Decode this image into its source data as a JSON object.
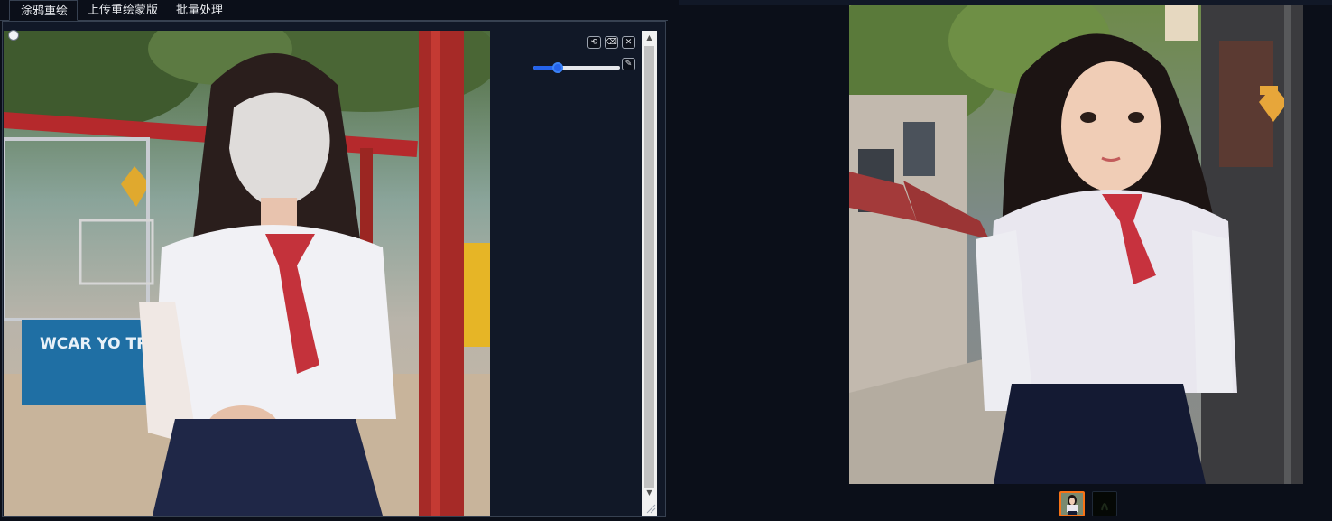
{
  "tabs": [
    {
      "label": "涂鸦重绘",
      "active": true
    },
    {
      "label": "上传重绘蒙版",
      "active": false
    },
    {
      "label": "批量处理",
      "active": false
    }
  ],
  "editor": {
    "tools": [
      {
        "name": "undo-icon",
        "glyph": "⟲"
      },
      {
        "name": "eraser-icon",
        "glyph": "⌫"
      },
      {
        "name": "clear-icon",
        "glyph": "✕"
      }
    ],
    "brush_tool_glyph": "✎",
    "brush_size_fraction": 0.25,
    "sign_text": "WCAR YO TRE"
  },
  "colors": {
    "accent": "#2563eb",
    "selected_thumb_border": "#f97316",
    "background": "#0b0f19",
    "panel": "#111827"
  },
  "gallery": {
    "thumbnails": [
      {
        "label": "result-1",
        "selected": true
      },
      {
        "label": "result-2",
        "selected": false
      }
    ]
  }
}
